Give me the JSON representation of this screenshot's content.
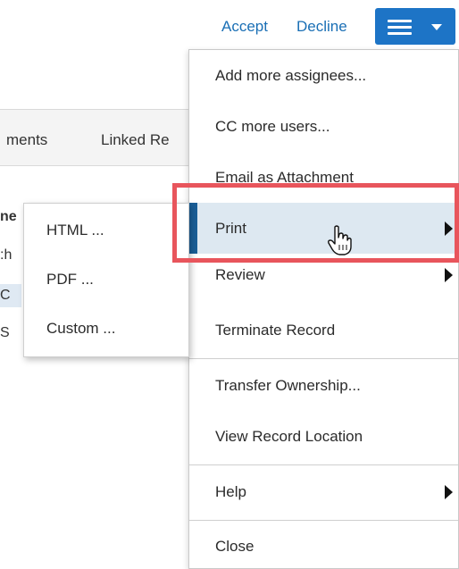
{
  "actions": {
    "accept_label": "Accept",
    "decline_label": "Decline",
    "menu_button_icon": "hamburger-menu-icon",
    "accent_color": "#1d74c6"
  },
  "background": {
    "tabs": [
      "ments",
      "Linked Re"
    ],
    "rows": [
      "ne",
      ":h",
      "C",
      "S"
    ]
  },
  "menu": {
    "items": [
      {
        "label": "Add more assignees..."
      },
      {
        "label": "CC more users..."
      },
      {
        "label": "Email as Attachment"
      },
      {
        "label": "Print",
        "has_submenu": true,
        "active": true
      },
      {
        "label": "Review",
        "has_submenu": true
      },
      {
        "label": "Terminate Record"
      },
      {
        "label": "Transfer Ownership..."
      },
      {
        "label": "View Record Location"
      },
      {
        "label": "Help",
        "has_submenu": true
      },
      {
        "label": "Close"
      }
    ]
  },
  "print_submenu": {
    "items": [
      {
        "label": "HTML ..."
      },
      {
        "label": "PDF ..."
      },
      {
        "label": "Custom ..."
      }
    ]
  },
  "highlight_color": "#e8555c",
  "cursor_icon": "hand-pointer-icon"
}
